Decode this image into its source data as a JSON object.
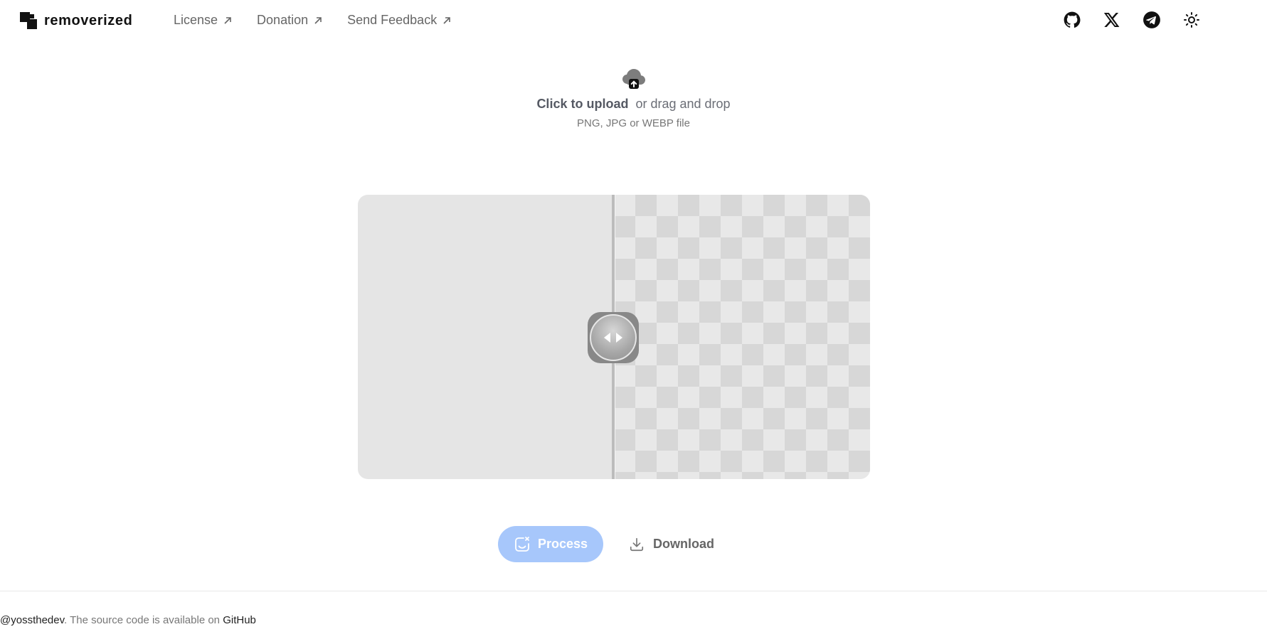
{
  "brand": {
    "name": "removerized"
  },
  "nav": [
    {
      "label": "License"
    },
    {
      "label": "Donation"
    },
    {
      "label": "Send Feedback"
    }
  ],
  "social": [
    "github-icon",
    "x-icon",
    "telegram-icon",
    "sun-icon"
  ],
  "upload": {
    "primary": "Click to upload",
    "secondary": "or drag and drop",
    "hint": "PNG, JPG or WEBP file"
  },
  "actions": {
    "process_label": "Process",
    "download_label": "Download"
  },
  "footer": {
    "handle": "@yossthedev",
    "text": ". The source code is available on ",
    "link": "GitHub"
  },
  "colors": {
    "process_bg": "#a7c7fb",
    "text_muted": "#666666"
  }
}
